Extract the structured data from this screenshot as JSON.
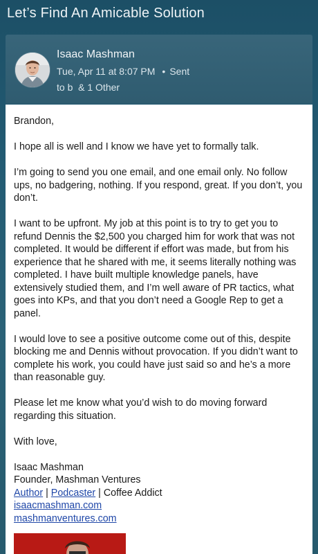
{
  "header": {
    "subject": "Let’s Find An Amicable Solution"
  },
  "message": {
    "sender_name": "Isaac Mashman",
    "date": "Tue, Apr 11 at 8:07 PM",
    "status": "Sent",
    "to": "to b  & 1 Other"
  },
  "body": {
    "greeting": "Brandon,",
    "paragraphs": [
      "I hope all is well and I know we have yet to formally talk.",
      "I’m going to send you one email, and one email only. No follow ups, no badgering, nothing. If you respond, great. If you don’t, you don’t.",
      "I want to be upfront. My job at this point is to try to get you to refund Dennis the $2,500 you charged him for work that was not completed. It would be different if effort was made, but from his experience that he shared with me, it seems literally nothing was completed. I have built multiple knowledge panels, have extensively studied them, and I’m well aware of PR tactics, what goes into KPs, and that you don’t need a Google Rep to get a panel.",
      "I would love to see a positive outcome come out of this, despite blocking me and Dennis without provocation. If you didn’t want to complete his work, you could have just said so and he’s a more than reasonable guy.",
      "Please let me know what you’d wish to do moving forward regarding this situation."
    ],
    "closing": "With love,"
  },
  "signature": {
    "name": "Isaac Mashman",
    "title": "Founder, Mashman Ventures",
    "link_author": "Author",
    "separator": " | ",
    "link_podcaster": "Podcaster",
    "tagline": "Coffee Addict",
    "website1": "isaacmashman.com",
    "website2": "mashmanventures.com"
  },
  "colors": {
    "link": "#1f47a8",
    "header_bg": "#2d6a83",
    "signature_banner": "#c8201a"
  }
}
